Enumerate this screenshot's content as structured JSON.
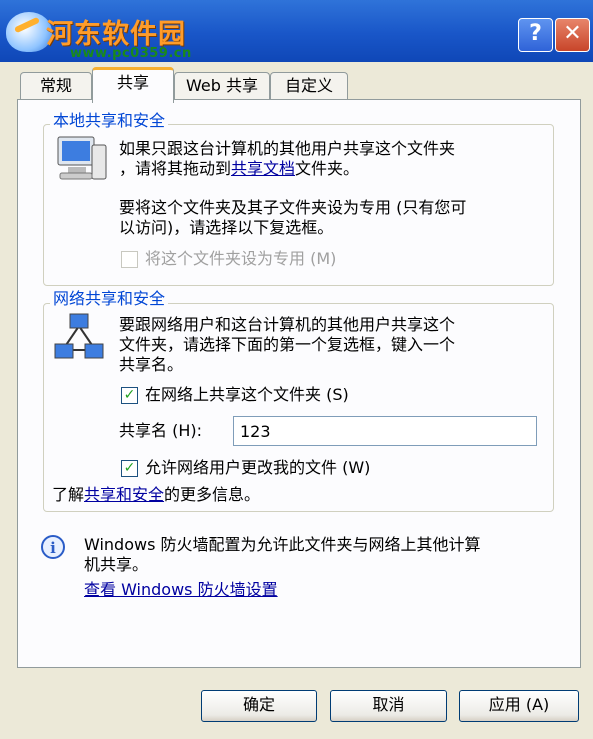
{
  "watermark": {
    "site": "河东软件园",
    "url": "www.pc0359.cn"
  },
  "titlebar": {
    "help_label": "?",
    "close_label": "✕"
  },
  "tabs": [
    {
      "label": "常规"
    },
    {
      "label": "共享"
    },
    {
      "label": "Web 共享"
    },
    {
      "label": "自定义"
    }
  ],
  "local": {
    "group_title": "本地共享和安全",
    "line1": "如果只跟这台计算机的其他用户共享这个文件夹",
    "line2_pre": "，请将其拖动到",
    "line2_link": "共享文档",
    "line2_post": "文件夹。",
    "line3": "要将这个文件夹及其子文件夹设为专用 (只有您可",
    "line4": "以访问)，请选择以下复选框。",
    "private_checkbox": "将这个文件夹设为专用 (M)"
  },
  "network": {
    "group_title": "网络共享和安全",
    "line1": "要跟网络用户和这台计算机的其他用户共享这个",
    "line2": "文件夹，请选择下面的第一个复选框，键入一个",
    "line3": "共享名。",
    "share_checkbox": "在网络上共享这个文件夹 (S)",
    "share_checked": "✓",
    "share_name_label": "共享名 (H):",
    "share_name_value": "123",
    "allow_checkbox": "允许网络用户更改我的文件 (W)",
    "allow_checked": "✓",
    "learn_pre": "了解",
    "learn_link": "共享和安全",
    "learn_post": "的更多信息。"
  },
  "firewall": {
    "info_icon": "i",
    "line1": "Windows 防火墙配置为允许此文件夹与网络上其他计算",
    "line2": "机共享。",
    "link": "查看 Windows 防火墙设置"
  },
  "buttons": {
    "ok": "确定",
    "cancel": "取消",
    "apply": "应用 (A)"
  },
  "colors": {
    "titlebar": "#1956c8",
    "group_label": "#0046d5",
    "link": "#0000a0",
    "dialog_bg": "#ece9d8"
  }
}
